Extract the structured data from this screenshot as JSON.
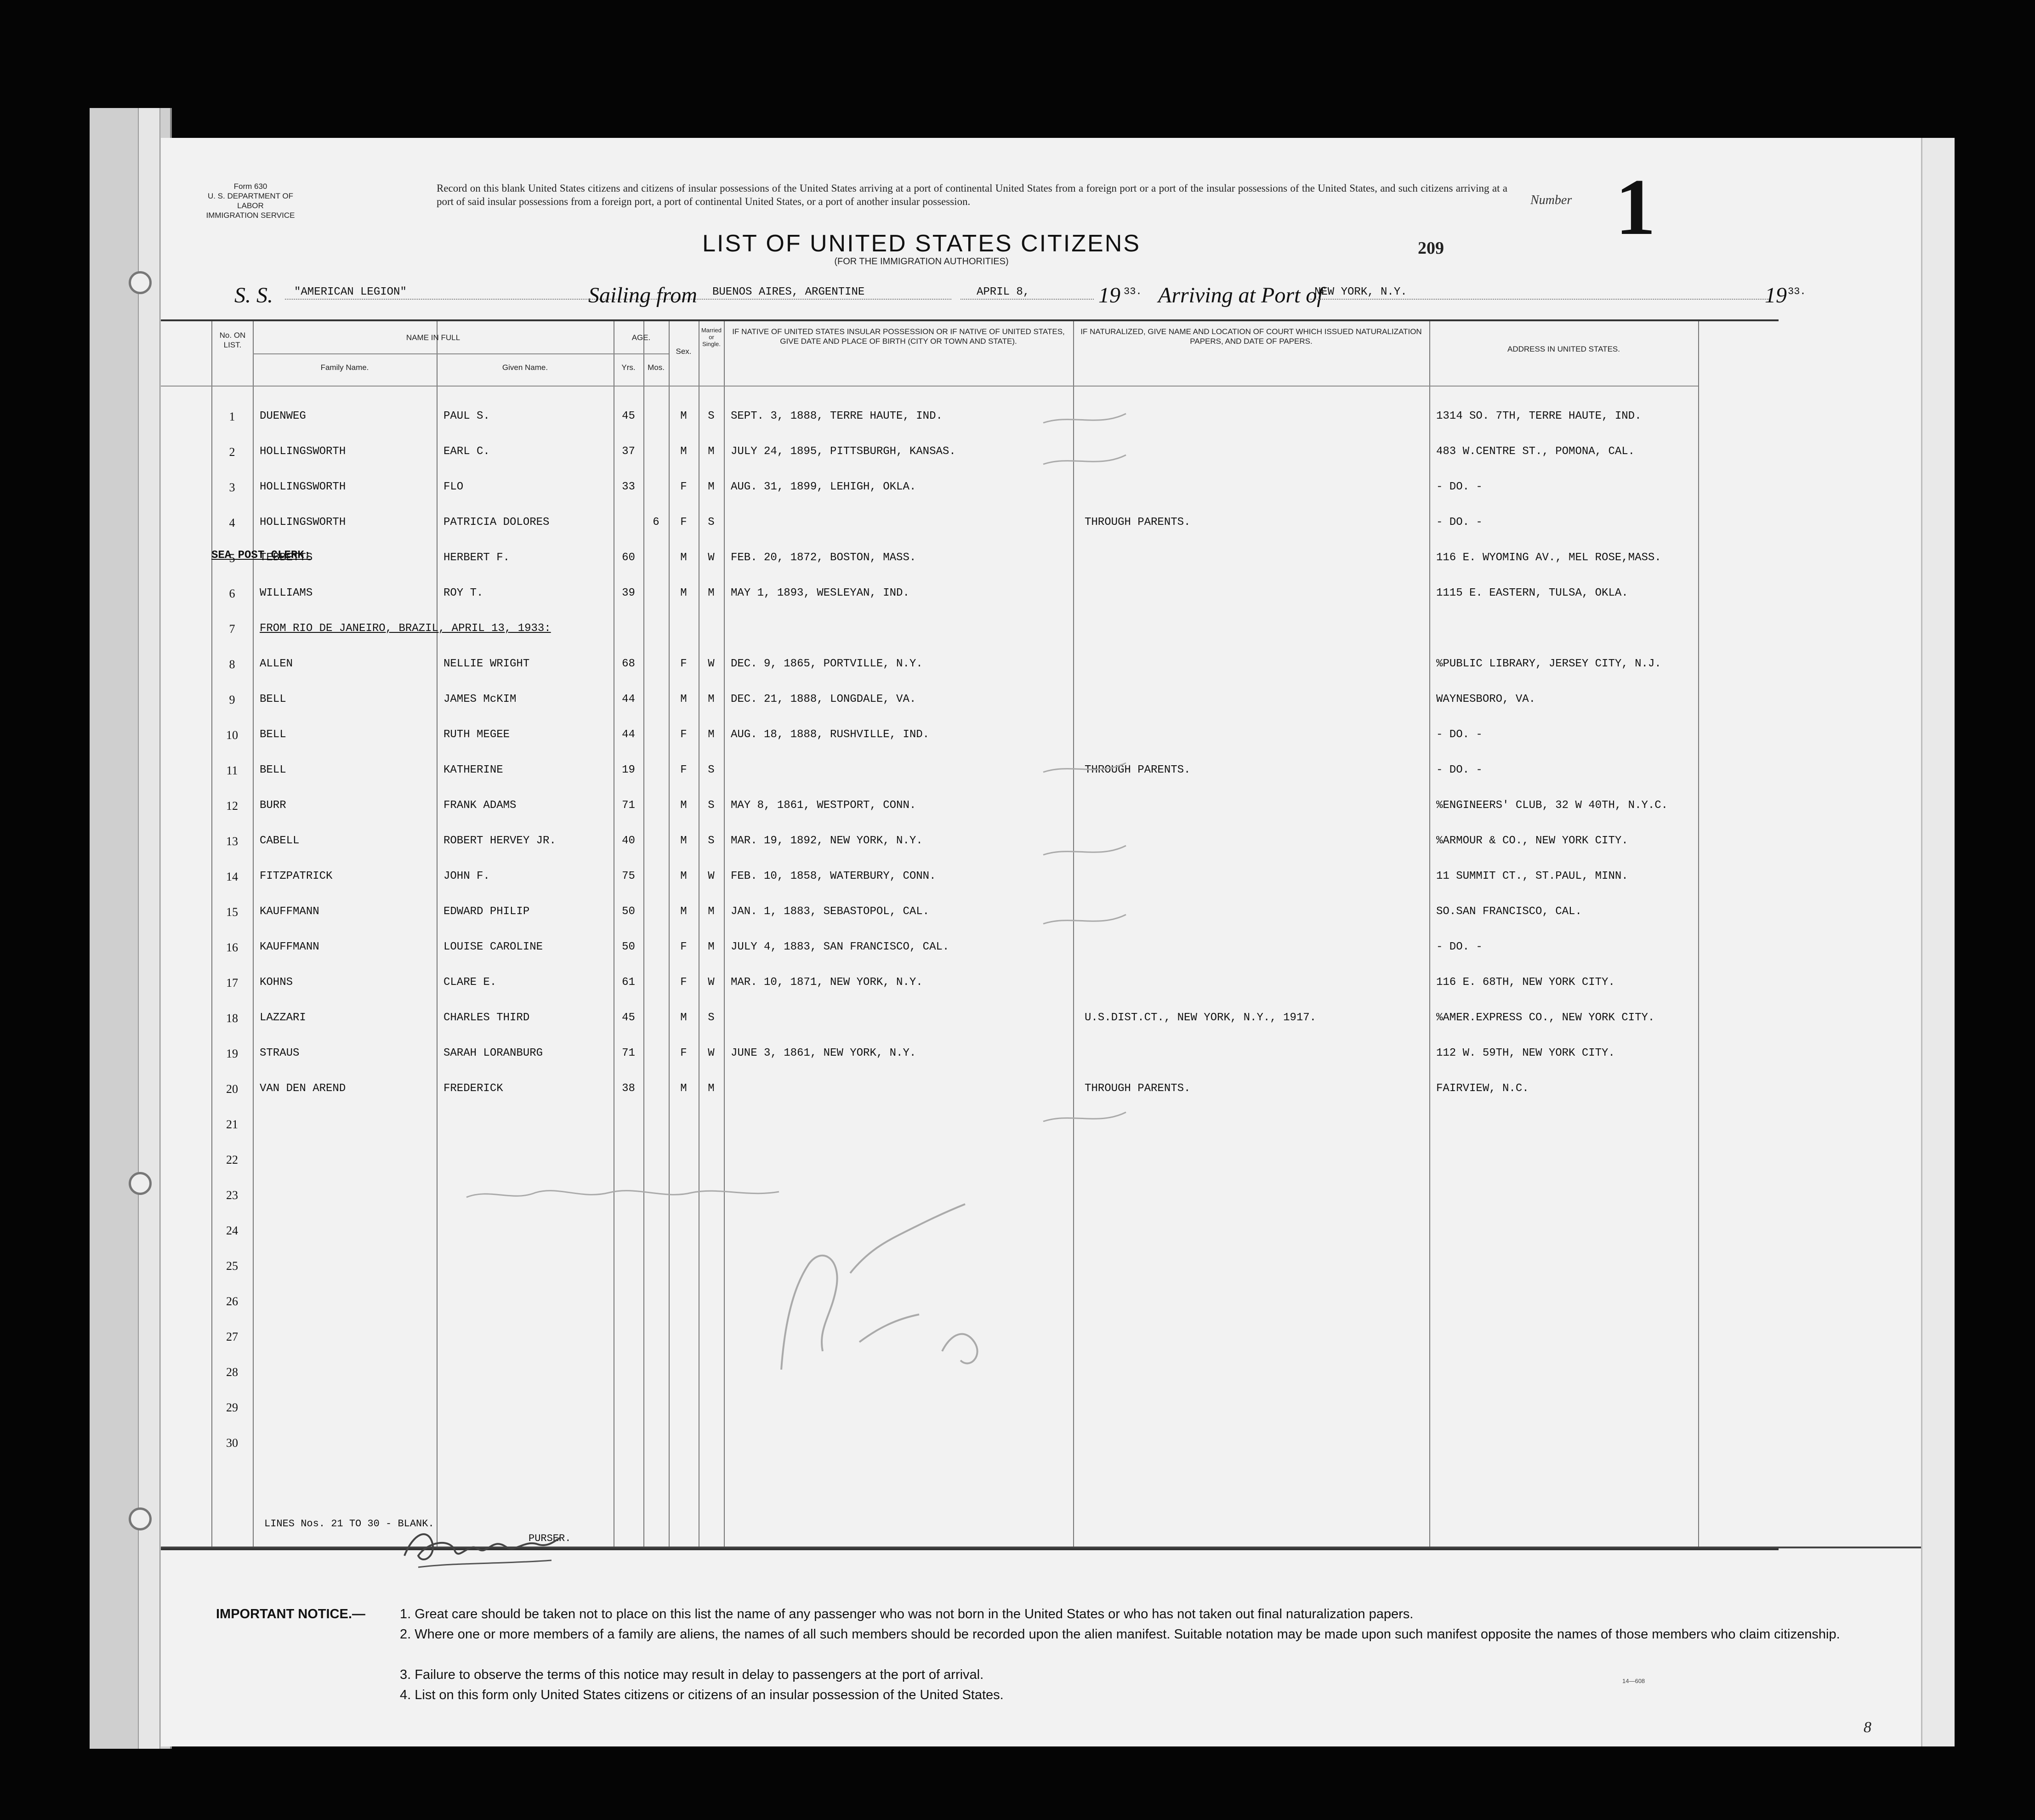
{
  "form": {
    "form_number": "Form 630",
    "department": "U. S. DEPARTMENT OF LABOR",
    "service": "IMMIGRATION SERVICE"
  },
  "header": {
    "record_text": "Record on this blank United States citizens and citizens of insular possessions of the United States arriving at a port of continental United States from a foreign port or a port of the insular possessions of the United States, and such citizens arriving at a port of said insular possessions from a foreign port, a port of continental United States, or a port of another insular possession.",
    "number_label": "Number",
    "number_value": "1",
    "title": "LIST OF UNITED STATES CITIZENS",
    "subtitle": "(FOR THE IMMIGRATION AUTHORITIES)",
    "stamp_number": "209"
  },
  "voyage": {
    "ss_label": "S. S.",
    "ship": "\"AMERICAN LEGION\"",
    "sailing_label": "Sailing from",
    "from": "BUENOS AIRES, ARGENTINE",
    "date": "APRIL 8,",
    "year_prefix": "19",
    "year_suffix": "33.",
    "arriving_label": "Arriving at Port of",
    "port": "NEW YORK, N.Y.",
    "arr_year_prefix": "19",
    "arr_year_suffix": "33."
  },
  "columns": {
    "no": "No. ON LIST.",
    "name": "NAME IN FULL",
    "family": "Family Name.",
    "given": "Given Name.",
    "age": "AGE.",
    "yrs": "Yrs.",
    "mos": "Mos.",
    "sex": "Sex.",
    "married": "Married or Single.",
    "birth": "IF NATIVE OF UNITED STATES INSULAR POSSESSION OR IF NATIVE OF UNITED STATES, GIVE DATE AND PLACE OF BIRTH (CITY OR TOWN AND STATE).",
    "naturalized": "IF NATURALIZED, GIVE NAME AND LOCATION OF COURT WHICH ISSUED NATURALIZATION PAPERS, AND DATE OF PAPERS.",
    "address": "ADDRESS IN UNITED STATES."
  },
  "rows": [
    {
      "no": "1",
      "family": "DUENWEG",
      "given": "PAUL S.",
      "yrs": "45",
      "mos": "",
      "sex": "M",
      "ms": "S",
      "birth": "SEPT. 3, 1888, TERRE HAUTE, IND.",
      "nat": "",
      "addr": "1314 SO. 7TH, TERRE HAUTE, IND."
    },
    {
      "no": "2",
      "family": "HOLLINGSWORTH",
      "given": "EARL C.",
      "yrs": "37",
      "mos": "",
      "sex": "M",
      "ms": "M",
      "birth": "JULY 24, 1895, PITTSBURGH, KANSAS.",
      "nat": "",
      "addr": "483 W.CENTRE ST., POMONA, CAL."
    },
    {
      "no": "3",
      "family": "HOLLINGSWORTH",
      "given": "FLO",
      "yrs": "33",
      "mos": "",
      "sex": "F",
      "ms": "M",
      "birth": "AUG. 31, 1899, LEHIGH, OKLA.",
      "nat": "",
      "addr": "- DO. -"
    },
    {
      "no": "4",
      "family": "HOLLINGSWORTH",
      "given": "PATRICIA DOLORES",
      "yrs": "",
      "mos": "6",
      "sex": "F",
      "ms": "S",
      "birth": "",
      "nat": "THROUGH PARENTS.",
      "addr": "- DO. -"
    },
    {
      "no": "5",
      "family": "TEBBETTS",
      "given": "HERBERT F.",
      "yrs": "60",
      "mos": "",
      "sex": "M",
      "ms": "W",
      "birth": "FEB. 20, 1872, BOSTON, MASS.",
      "nat": "",
      "addr": "116 E. WYOMING AV., MEL ROSE,MASS."
    },
    {
      "no": "6",
      "family": "WILLIAMS",
      "given": "ROY T.",
      "yrs": "39",
      "mos": "",
      "sex": "M",
      "ms": "M",
      "birth": "MAY  1, 1893, WESLEYAN, IND.",
      "nat": "",
      "addr": "1115 E. EASTERN, TULSA, OKLA."
    },
    {
      "no": "7",
      "family": "FROM RIO DE JANEIRO, BRAZIL, APRIL 13, 1933:",
      "given": "",
      "yrs": "",
      "mos": "",
      "sex": "",
      "ms": "",
      "birth": "",
      "nat": "",
      "addr": ""
    },
    {
      "no": "8",
      "family": "ALLEN",
      "given": "NELLIE WRIGHT",
      "yrs": "68",
      "mos": "",
      "sex": "F",
      "ms": "W",
      "birth": "DEC. 9, 1865, PORTVILLE, N.Y.",
      "nat": "",
      "addr": "%PUBLIC LIBRARY, JERSEY CITY, N.J."
    },
    {
      "no": "9",
      "family": "BELL",
      "given": "JAMES McKIM",
      "yrs": "44",
      "mos": "",
      "sex": "M",
      "ms": "M",
      "birth": "DEC. 21, 1888, LONGDALE, VA.",
      "nat": "",
      "addr": "WAYNESBORO, VA."
    },
    {
      "no": "10",
      "family": "BELL",
      "given": "RUTH MEGEE",
      "yrs": "44",
      "mos": "",
      "sex": "F",
      "ms": "M",
      "birth": "AUG. 18, 1888, RUSHVILLE, IND.",
      "nat": "",
      "addr": "- DO. -"
    },
    {
      "no": "11",
      "family": "BELL",
      "given": "KATHERINE",
      "yrs": "19",
      "mos": "",
      "sex": "F",
      "ms": "S",
      "birth": "",
      "nat": "THROUGH PARENTS.",
      "addr": "- DO. -"
    },
    {
      "no": "12",
      "family": "BURR",
      "given": "FRANK ADAMS",
      "yrs": "71",
      "mos": "",
      "sex": "M",
      "ms": "S",
      "birth": "MAY  8, 1861, WESTPORT, CONN.",
      "nat": "",
      "addr": "%ENGINEERS' CLUB, 32 W 40TH, N.Y.C."
    },
    {
      "no": "13",
      "family": "CABELL",
      "given": "ROBERT HERVEY JR.",
      "yrs": "40",
      "mos": "",
      "sex": "M",
      "ms": "S",
      "birth": "MAR. 19, 1892, NEW YORK, N.Y.",
      "nat": "",
      "addr": "%ARMOUR & CO., NEW YORK CITY."
    },
    {
      "no": "14",
      "family": "FITZPATRICK",
      "given": "JOHN F.",
      "yrs": "75",
      "mos": "",
      "sex": "M",
      "ms": "W",
      "birth": "FEB. 10, 1858, WATERBURY, CONN.",
      "nat": "",
      "addr": "11 SUMMIT CT., ST.PAUL, MINN."
    },
    {
      "no": "15",
      "family": "KAUFFMANN",
      "given": "EDWARD PHILIP",
      "yrs": "50",
      "mos": "",
      "sex": "M",
      "ms": "M",
      "birth": "JAN. 1, 1883, SEBASTOPOL, CAL.",
      "nat": "",
      "addr": "SO.SAN FRANCISCO, CAL."
    },
    {
      "no": "16",
      "family": "KAUFFMANN",
      "given": "LOUISE CAROLINE",
      "yrs": "50",
      "mos": "",
      "sex": "F",
      "ms": "M",
      "birth": "JULY 4, 1883, SAN FRANCISCO, CAL.",
      "nat": "",
      "addr": "- DO. -"
    },
    {
      "no": "17",
      "family": "KOHNS",
      "given": "CLARE E.",
      "yrs": "61",
      "mos": "",
      "sex": "F",
      "ms": "W",
      "birth": "MAR. 10, 1871, NEW YORK, N.Y.",
      "nat": "",
      "addr": "116 E. 68TH, NEW YORK CITY."
    },
    {
      "no": "18",
      "family": "LAZZARI",
      "given": "CHARLES THIRD",
      "yrs": "45",
      "mos": "",
      "sex": "M",
      "ms": "S",
      "birth": "",
      "nat": "U.S.DIST.CT., NEW YORK, N.Y., 1917.",
      "addr": "%AMER.EXPRESS CO., NEW YORK CITY."
    },
    {
      "no": "19",
      "family": "STRAUS",
      "given": "SARAH LORANBURG",
      "yrs": "71",
      "mos": "",
      "sex": "F",
      "ms": "W",
      "birth": "JUNE 3, 1861, NEW YORK, N.Y.",
      "nat": "",
      "addr": "112 W. 59TH, NEW YORK CITY."
    },
    {
      "no": "20",
      "family": "VAN DEN AREND",
      "given": "FREDERICK",
      "yrs": "38",
      "mos": "",
      "sex": "M",
      "ms": "M",
      "birth": "",
      "nat": "THROUGH PARENTS.",
      "addr": "FAIRVIEW, N.C."
    },
    {
      "no": "21",
      "family": "",
      "given": "",
      "yrs": "",
      "mos": "",
      "sex": "",
      "ms": "",
      "birth": "",
      "nat": "",
      "addr": ""
    },
    {
      "no": "22",
      "family": "",
      "given": "",
      "yrs": "",
      "mos": "",
      "sex": "",
      "ms": "",
      "birth": "",
      "nat": "",
      "addr": ""
    },
    {
      "no": "23",
      "family": "",
      "given": "",
      "yrs": "",
      "mos": "",
      "sex": "",
      "ms": "",
      "birth": "",
      "nat": "",
      "addr": ""
    },
    {
      "no": "24",
      "family": "",
      "given": "",
      "yrs": "",
      "mos": "",
      "sex": "",
      "ms": "",
      "birth": "",
      "nat": "",
      "addr": ""
    },
    {
      "no": "25",
      "family": "",
      "given": "",
      "yrs": "",
      "mos": "",
      "sex": "",
      "ms": "",
      "birth": "",
      "nat": "",
      "addr": ""
    },
    {
      "no": "26",
      "family": "",
      "given": "",
      "yrs": "",
      "mos": "",
      "sex": "",
      "ms": "",
      "birth": "",
      "nat": "",
      "addr": ""
    },
    {
      "no": "27",
      "family": "",
      "given": "",
      "yrs": "",
      "mos": "",
      "sex": "",
      "ms": "",
      "birth": "",
      "nat": "",
      "addr": ""
    },
    {
      "no": "28",
      "family": "",
      "given": "",
      "yrs": "",
      "mos": "",
      "sex": "",
      "ms": "",
      "birth": "",
      "nat": "",
      "addr": ""
    },
    {
      "no": "29",
      "family": "",
      "given": "",
      "yrs": "",
      "mos": "",
      "sex": "",
      "ms": "",
      "birth": "",
      "nat": "",
      "addr": ""
    },
    {
      "no": "30",
      "family": "",
      "given": "",
      "yrs": "",
      "mos": "",
      "sex": "",
      "ms": "",
      "birth": "",
      "nat": "",
      "addr": ""
    }
  ],
  "annotations": {
    "sea_post_clerk": "SEA POST CLERK:",
    "lines_blank": "LINES Nos. 21 TO 30 - BLANK.",
    "purser": "PURSER."
  },
  "notice": {
    "heading": "IMPORTANT NOTICE.—",
    "items": [
      "1. Great care should be taken not to place on this list the name of any passenger who was not born in the United States or who has not taken out final naturalization papers.",
      "2. Where one or more members of a family are aliens, the names of all such members should be recorded upon the alien manifest.  Suitable notation may be made upon such manifest opposite the names of those members who claim citizenship.",
      "3. Failure to observe the terms of this notice may result in delay to passengers at the port of arrival.",
      "4. List on this form only United States citizens or citizens of an insular possession of the United States."
    ],
    "form_code": "14—608",
    "page_number": "8"
  }
}
